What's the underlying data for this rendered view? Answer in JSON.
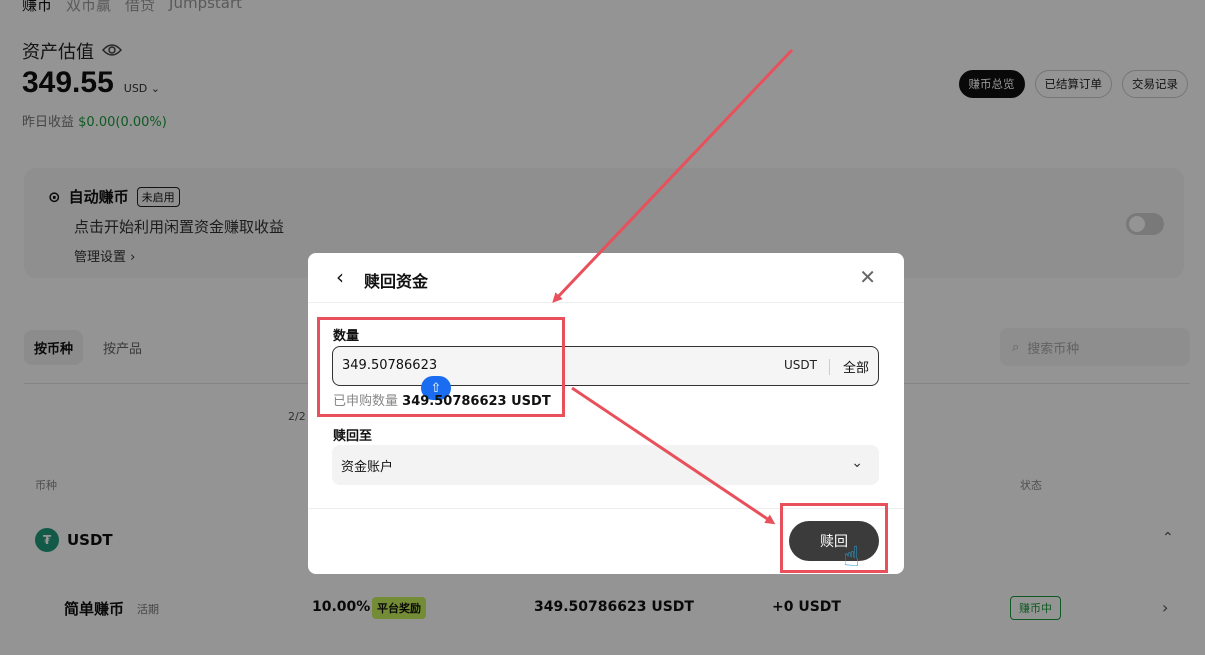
{
  "top_tabs": [
    "赚币",
    "双币赢",
    "借贷",
    "Jumpstart"
  ],
  "asset": {
    "label": "资产估值",
    "value": "349.55",
    "currency": "USD",
    "yesterday_label": "昨日收益",
    "yesterday_value": "$0.00(0.00%)"
  },
  "top_buttons": [
    "赚币总览",
    "已结算订单",
    "交易记录"
  ],
  "auto_earn": {
    "title": "自动赚币",
    "badge": "未启用",
    "description": "点击开始利用闲置资金赚取收益",
    "manage": "管理设置"
  },
  "filter_tabs": [
    "按币种",
    "按产品"
  ],
  "search_placeholder": "搜索币种",
  "pager": "2/2",
  "columns": {
    "coin": "币种",
    "status": "状态"
  },
  "coin": {
    "name": "USDT"
  },
  "product_row": {
    "name": "简单赚币",
    "tag": "活期",
    "rate": "10.00%",
    "bonus": "平台奖励",
    "amount": "349.50786623 USDT",
    "earnings": "+0 USDT",
    "status": "赚币中"
  },
  "modal": {
    "title": "赎回资金",
    "quantity_label": "数量",
    "quantity_value": "349.50786623",
    "quantity_unit": "USDT",
    "all_label": "全部",
    "subscribed_label": "已申购数量",
    "subscribed_value": "349.50786623 USDT",
    "redeem_to_label": "赎回至",
    "redeem_to_value": "资金账户",
    "redeem_button": "赎回"
  },
  "colors": {
    "annotation_red": "#e8505b",
    "positive_green": "#1a9b3c",
    "accent_blue": "#1a6cf0"
  }
}
